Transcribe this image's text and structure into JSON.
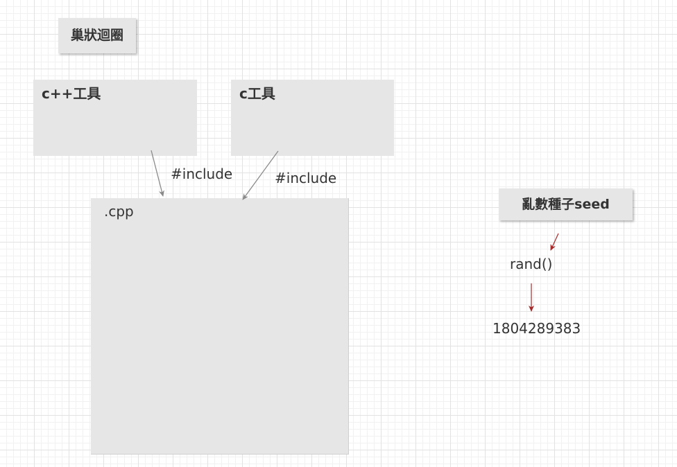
{
  "diagram": {
    "title": "巢狀迴圈",
    "cpp_tools_label": "c++工具",
    "c_tools_label": "c工具",
    "cpp_file_label": ".cpp",
    "include_label_1": "#include",
    "include_label_2": "#include",
    "seed_label": "亂數種子seed",
    "rand_label": "rand()",
    "result_label": "1804289383"
  },
  "colors": {
    "box_fill": "#e6e6e6",
    "text": "#333333",
    "include_arrow": "#8a8a8a",
    "seed_arrow": "#a52a2a"
  }
}
